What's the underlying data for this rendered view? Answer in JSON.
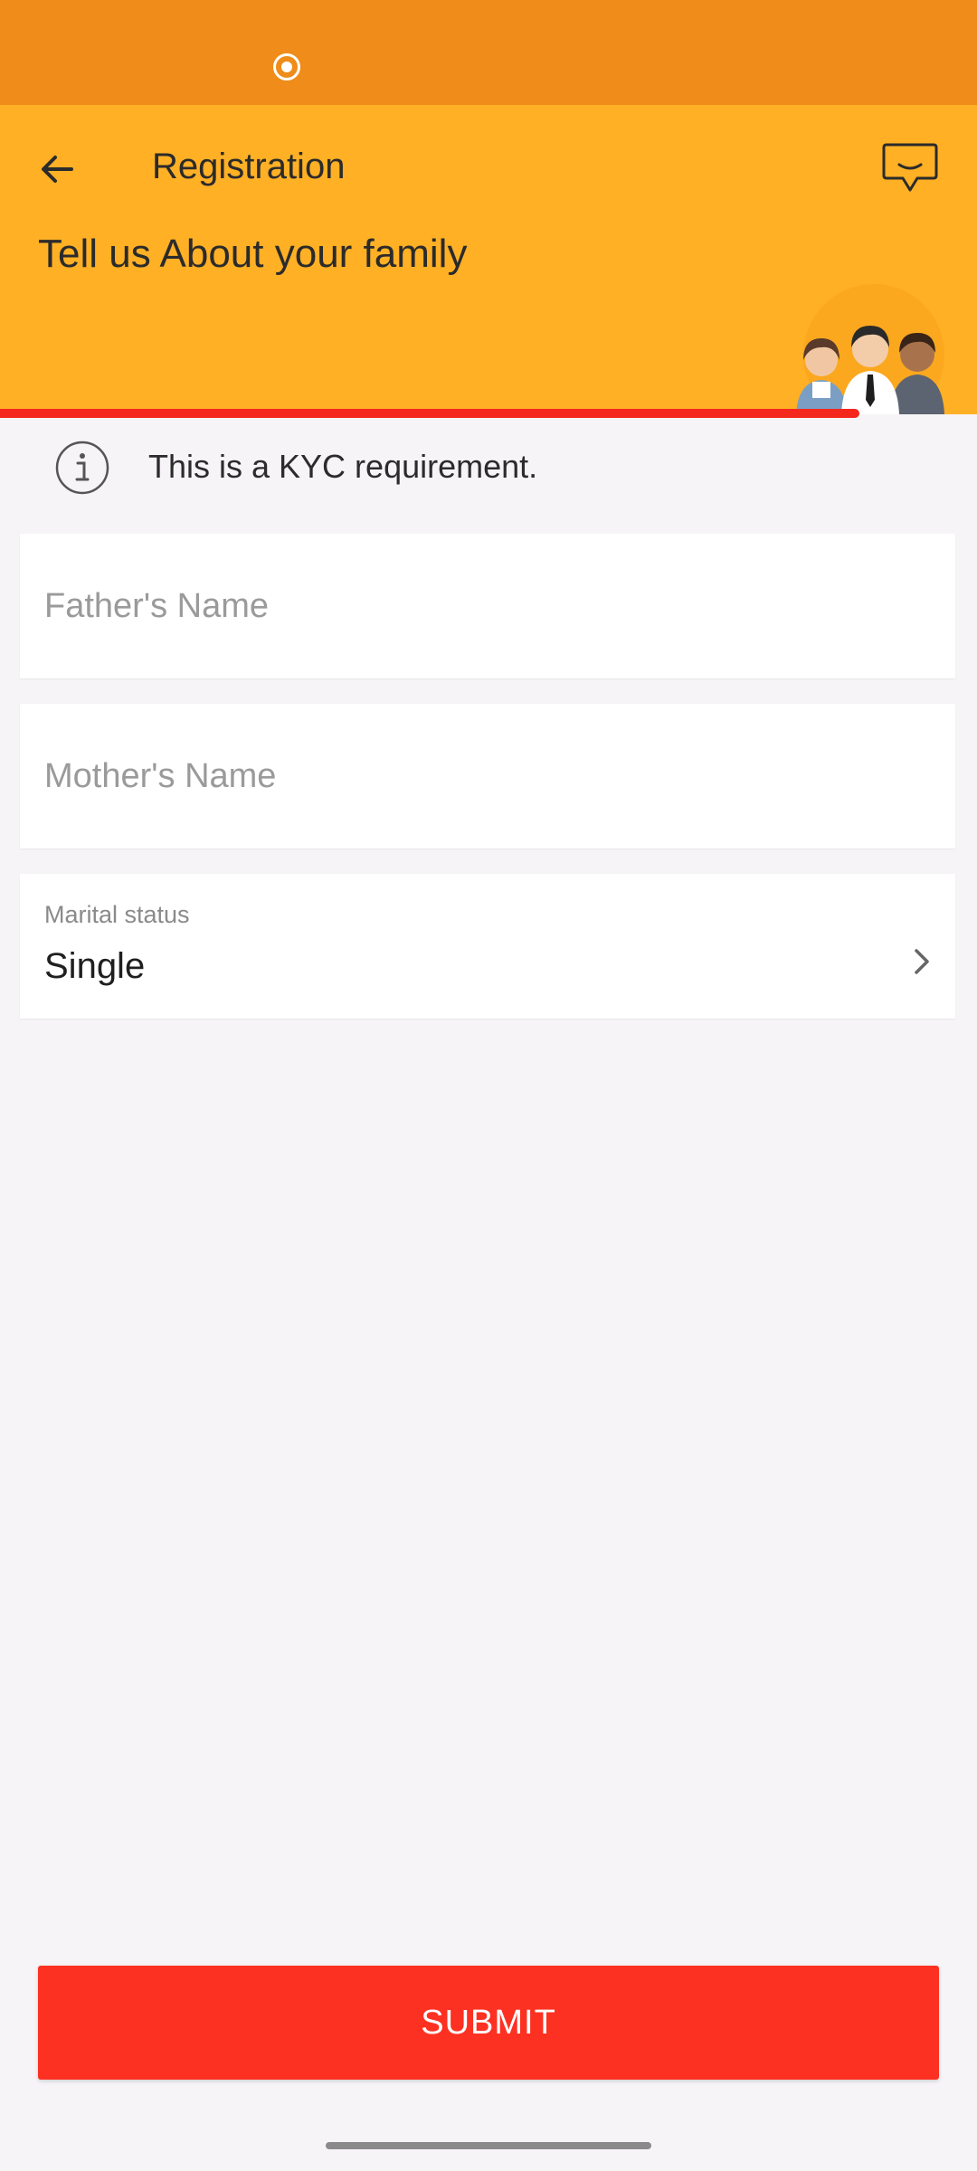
{
  "header": {
    "title": "Registration",
    "heading": "Tell us About your family",
    "back_icon": "arrow-left-icon",
    "chat_icon": "chat-bubble-icon",
    "illustration": "family-illustration"
  },
  "progress": {
    "fraction": 0.88
  },
  "notice": {
    "icon": "info-icon",
    "text": "This is a KYC requirement."
  },
  "form": {
    "father_name": {
      "placeholder": "Father's Name",
      "value": ""
    },
    "mother_name": {
      "placeholder": "Mother's Name",
      "value": ""
    },
    "marital_status": {
      "label": "Marital status",
      "value": "Single",
      "icon": "chevron-right-icon"
    }
  },
  "actions": {
    "submit_label": "SUBMIT"
  },
  "colors": {
    "status_bar": "#ef8c1a",
    "header": "#ffb025",
    "progress": "#f5281e",
    "submit": "#fd3121",
    "background": "#f6f4f6"
  }
}
